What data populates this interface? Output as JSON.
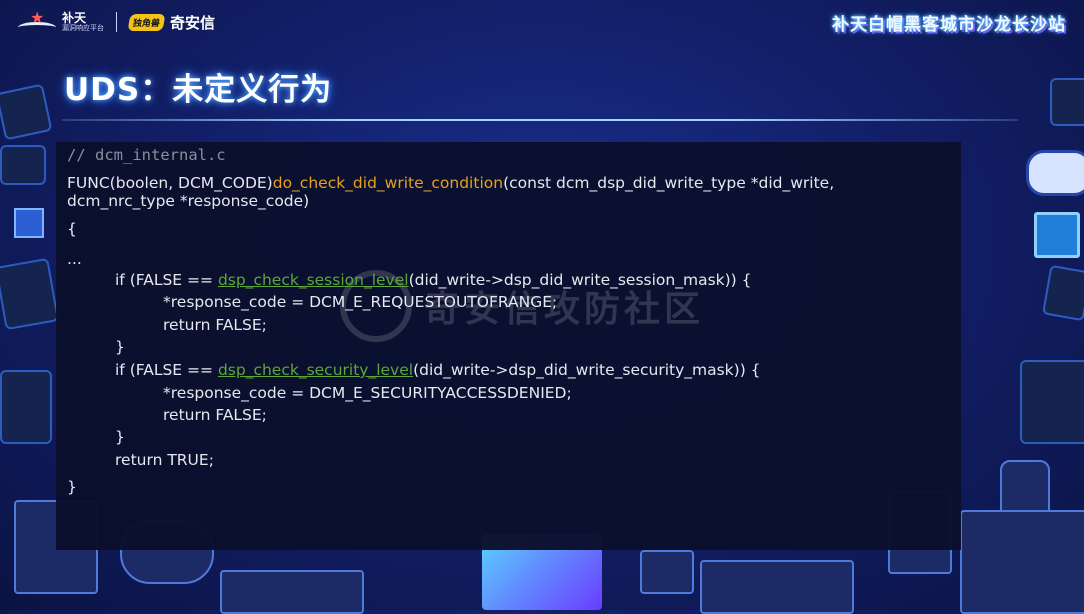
{
  "header": {
    "brand_a_name": "补天",
    "brand_a_sub": "漏洞响应平台",
    "brand_b_badge": "独角兽",
    "brand_b_name": "奇安信",
    "event_title": "补天白帽黑客城市沙龙长沙站"
  },
  "slide": {
    "title": "UDS：未定义行为"
  },
  "code": {
    "lines": [
      "// dcm_internal.c",
      "FUNC(boolen, DCM_CODE)do_check_did_write_condition(const dcm_dsp_did_write_type *did_write,",
      "dcm_nrc_type *response_code)",
      "{",
      "...",
      "if (FALSE == dsp_check_session_level(did_write->dsp_did_write_session_mask)) {",
      "*response_code = DCM_E_REQUESTOUTOFRANGE;",
      "return FALSE;",
      "}",
      "if (FALSE == dsp_check_security_level(did_write->dsp_did_write_security_mask)) {",
      "*response_code = DCM_E_SECURITYACCESSDENIED;",
      "return FALSE;",
      "}",
      "return TRUE;",
      "}"
    ],
    "tokens": {
      "func_prefix": "FUNC(boolen, DCM_CODE)",
      "func_name": "do_check_did_write_condition",
      "func_args": "(const dcm_dsp_did_write_type *did_write,",
      "if_prefix": "if (FALSE == ",
      "session_fn": "dsp_check_session_level",
      "session_args": "(did_write->dsp_did_write_session_mask)) {",
      "security_fn": "dsp_check_security_level",
      "security_args": "(did_write->dsp_did_write_security_mask)) {"
    }
  },
  "watermark": "奇安信攻防社区",
  "colors": {
    "function_name": "#e8a020",
    "called_function": "#5da63a",
    "comment": "#8a8f9e",
    "code_text": "#e6e8f0",
    "code_background": "#0a0f2c"
  }
}
